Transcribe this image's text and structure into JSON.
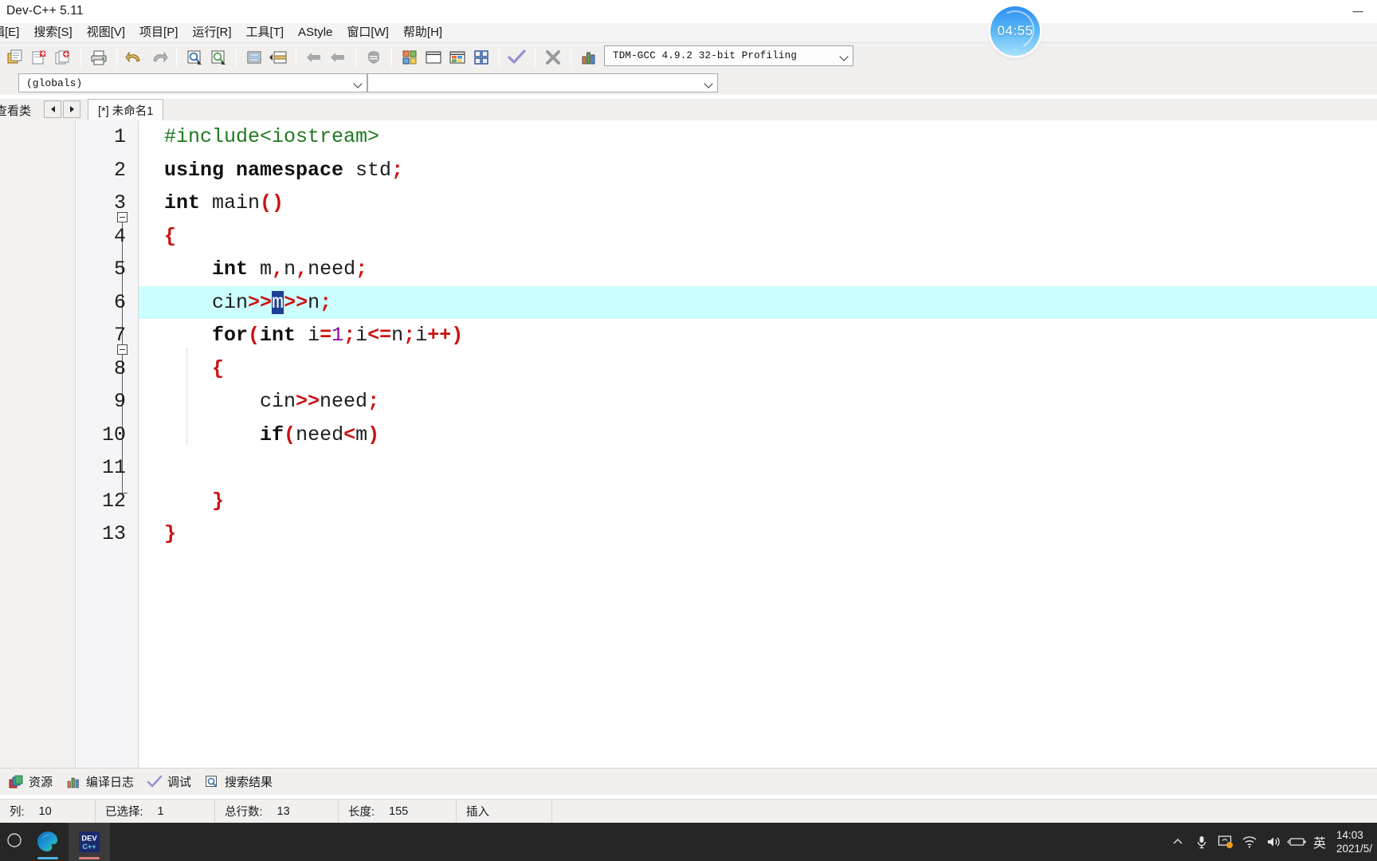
{
  "window": {
    "title": "Dev-C++ 5.11",
    "minimize_label": "—"
  },
  "menubar": {
    "items": [
      {
        "label": "辑[E]"
      },
      {
        "label": "搜索[S]"
      },
      {
        "label": "视图[V]"
      },
      {
        "label": "项目[P]"
      },
      {
        "label": "运行[R]"
      },
      {
        "label": "工具[T]"
      },
      {
        "label": "AStyle"
      },
      {
        "label": "窗口[W]"
      },
      {
        "label": "帮助[H]"
      }
    ]
  },
  "toolbar": {
    "compiler_select": {
      "value": "TDM-GCC 4.9.2 32-bit Profiling",
      "chevron_icon": "chevron-down-icon"
    },
    "buttons": [
      {
        "name": "new-file-button",
        "icon": "new-file-icon"
      },
      {
        "name": "open-file-button",
        "icon": "open-folder-icon"
      },
      {
        "name": "save-file-button",
        "icon": "save-icon"
      },
      {
        "name": "print-button",
        "icon": "printer-icon"
      },
      {
        "name": "undo-button",
        "icon": "undo-arrow-icon"
      },
      {
        "name": "redo-button",
        "icon": "redo-arrow-icon"
      },
      {
        "name": "find-button",
        "icon": "magnifier-icon"
      },
      {
        "name": "find-next-button",
        "icon": "magnifier-next-icon"
      },
      {
        "name": "goto-line-button",
        "icon": "goto-line-icon"
      },
      {
        "name": "goto-function-button",
        "icon": "goto-function-icon"
      },
      {
        "name": "step-back-button",
        "icon": "left-block-icon"
      },
      {
        "name": "step-forward-button",
        "icon": "left-block-icon-2"
      },
      {
        "name": "bookmark-button",
        "icon": "shield-icon"
      },
      {
        "name": "compile-button",
        "icon": "compile-squares-icon"
      },
      {
        "name": "run-button",
        "icon": "run-window-icon"
      },
      {
        "name": "compile-run-button",
        "icon": "compile-run-icon"
      },
      {
        "name": "rebuild-button",
        "icon": "rebuild-grid-icon"
      },
      {
        "name": "syntax-check-button",
        "icon": "check-mark-icon"
      },
      {
        "name": "stop-button",
        "icon": "stop-x-icon"
      },
      {
        "name": "profile-button",
        "icon": "bar-chart-icon"
      },
      {
        "name": "debug-button",
        "icon": "debug-bug-icon"
      }
    ]
  },
  "navbar": {
    "scope_combo": {
      "value": "(globals)",
      "chevron_icon": "chevron-down-icon"
    },
    "member_combo": {
      "value": "",
      "chevron_icon": "chevron-down-icon"
    }
  },
  "tabstrip": {
    "class_panel_label": "查看类",
    "prev_arrow_icon": "triangle-left-icon",
    "next_arrow_icon": "triangle-right-icon",
    "active_tab": "[*] 未命名1"
  },
  "editor": {
    "lines": [
      {
        "no": "1",
        "tokens": [
          {
            "t": "#include<iostream>",
            "c": "pp"
          }
        ]
      },
      {
        "no": "2",
        "tokens": [
          {
            "t": "using namespace",
            "c": "kw"
          },
          {
            "t": " std",
            "c": ""
          },
          {
            "t": ";",
            "c": "sym"
          }
        ]
      },
      {
        "no": "3",
        "tokens": [
          {
            "t": "int",
            "c": "kw"
          },
          {
            "t": " main",
            "c": ""
          },
          {
            "t": "()",
            "c": "sym"
          }
        ]
      },
      {
        "no": "4",
        "tokens": [
          {
            "t": "{",
            "c": "sym"
          }
        ]
      },
      {
        "no": "5",
        "tokens": [
          {
            "t": "    ",
            "c": ""
          },
          {
            "t": "int",
            "c": "kw"
          },
          {
            "t": " m",
            "c": ""
          },
          {
            "t": ",",
            "c": "sym"
          },
          {
            "t": "n",
            "c": ""
          },
          {
            "t": ",",
            "c": "sym"
          },
          {
            "t": "need",
            "c": ""
          },
          {
            "t": ";",
            "c": "sym"
          }
        ]
      },
      {
        "no": "6",
        "tokens": [
          {
            "t": "    cin",
            "c": ""
          },
          {
            "t": ">>",
            "c": "sym"
          },
          {
            "t": "m",
            "c": "sel"
          },
          {
            "t": ">>",
            "c": "sym"
          },
          {
            "t": "n",
            "c": ""
          },
          {
            "t": ";",
            "c": "sym"
          }
        ]
      },
      {
        "no": "7",
        "tokens": [
          {
            "t": "    ",
            "c": ""
          },
          {
            "t": "for",
            "c": "kw"
          },
          {
            "t": "(",
            "c": "sym"
          },
          {
            "t": "int",
            "c": "kw"
          },
          {
            "t": " i",
            "c": ""
          },
          {
            "t": "=",
            "c": "sym"
          },
          {
            "t": "1",
            "c": "num"
          },
          {
            "t": ";",
            "c": "sym"
          },
          {
            "t": "i",
            "c": ""
          },
          {
            "t": "<=",
            "c": "sym"
          },
          {
            "t": "n",
            "c": ""
          },
          {
            "t": ";",
            "c": "sym"
          },
          {
            "t": "i",
            "c": ""
          },
          {
            "t": "++",
            "c": "sym"
          },
          {
            "t": ")",
            "c": "sym"
          }
        ]
      },
      {
        "no": "8",
        "tokens": [
          {
            "t": "    ",
            "c": ""
          },
          {
            "t": "{",
            "c": "sym"
          }
        ]
      },
      {
        "no": "9",
        "tokens": [
          {
            "t": "        cin",
            "c": ""
          },
          {
            "t": ">>",
            "c": "sym"
          },
          {
            "t": "need",
            "c": ""
          },
          {
            "t": ";",
            "c": "sym"
          }
        ]
      },
      {
        "no": "10",
        "tokens": [
          {
            "t": "        ",
            "c": ""
          },
          {
            "t": "if",
            "c": "kw"
          },
          {
            "t": "(",
            "c": "sym"
          },
          {
            "t": "need",
            "c": ""
          },
          {
            "t": "<",
            "c": "sym"
          },
          {
            "t": "m",
            "c": ""
          },
          {
            "t": ")",
            "c": "sym"
          }
        ]
      },
      {
        "no": "11",
        "tokens": []
      },
      {
        "no": "12",
        "tokens": [
          {
            "t": "    ",
            "c": ""
          },
          {
            "t": "}",
            "c": "sym"
          }
        ]
      },
      {
        "no": "13",
        "tokens": [
          {
            "t": "}",
            "c": "sym"
          }
        ]
      }
    ],
    "current_line": 6,
    "selection_text": "m",
    "colors": {
      "current_line_bg": "#ccffff",
      "selection_bg": "#1c3f94",
      "preprocessor": "#1f7a1f",
      "keyword": "#111111",
      "symbol": "#cc1111",
      "number": "#8800aa",
      "plain": "#1d1d1d"
    }
  },
  "bottom_tabs": [
    {
      "label": "资源",
      "icon": "resources-icon"
    },
    {
      "label": "编译日志",
      "icon": "bar-chart-icon"
    },
    {
      "label": "调试",
      "icon": "check-mark-icon"
    },
    {
      "label": "搜索结果",
      "icon": "magnifier-icon"
    }
  ],
  "statusbar": [
    {
      "key": "列:",
      "value": "10"
    },
    {
      "key": "已选择:",
      "value": "1"
    },
    {
      "key": "总行数:",
      "value": "13"
    },
    {
      "key": "长度:",
      "value": "155"
    },
    {
      "key": "插入",
      "value": ""
    }
  ],
  "timer_widget": {
    "value": "04:55"
  },
  "taskbar": {
    "start_icon": "windows-start-icon",
    "apps": [
      {
        "name": "edge",
        "icon": "edge-browser-icon",
        "accent": "#4fb3e8"
      },
      {
        "name": "devcpp",
        "icon": "devcpp-icon",
        "label": "DEV",
        "sub": "C++",
        "accent": "#e06060"
      }
    ],
    "tray": {
      "overflow_icon": "chevron-up-icon",
      "icons": [
        {
          "name": "microphone-icon"
        },
        {
          "name": "display-cast-icon"
        },
        {
          "name": "wifi-icon"
        },
        {
          "name": "volume-icon"
        },
        {
          "name": "battery-icon"
        }
      ],
      "ime": "英",
      "time": "14:03",
      "date": "2021/5/"
    }
  }
}
